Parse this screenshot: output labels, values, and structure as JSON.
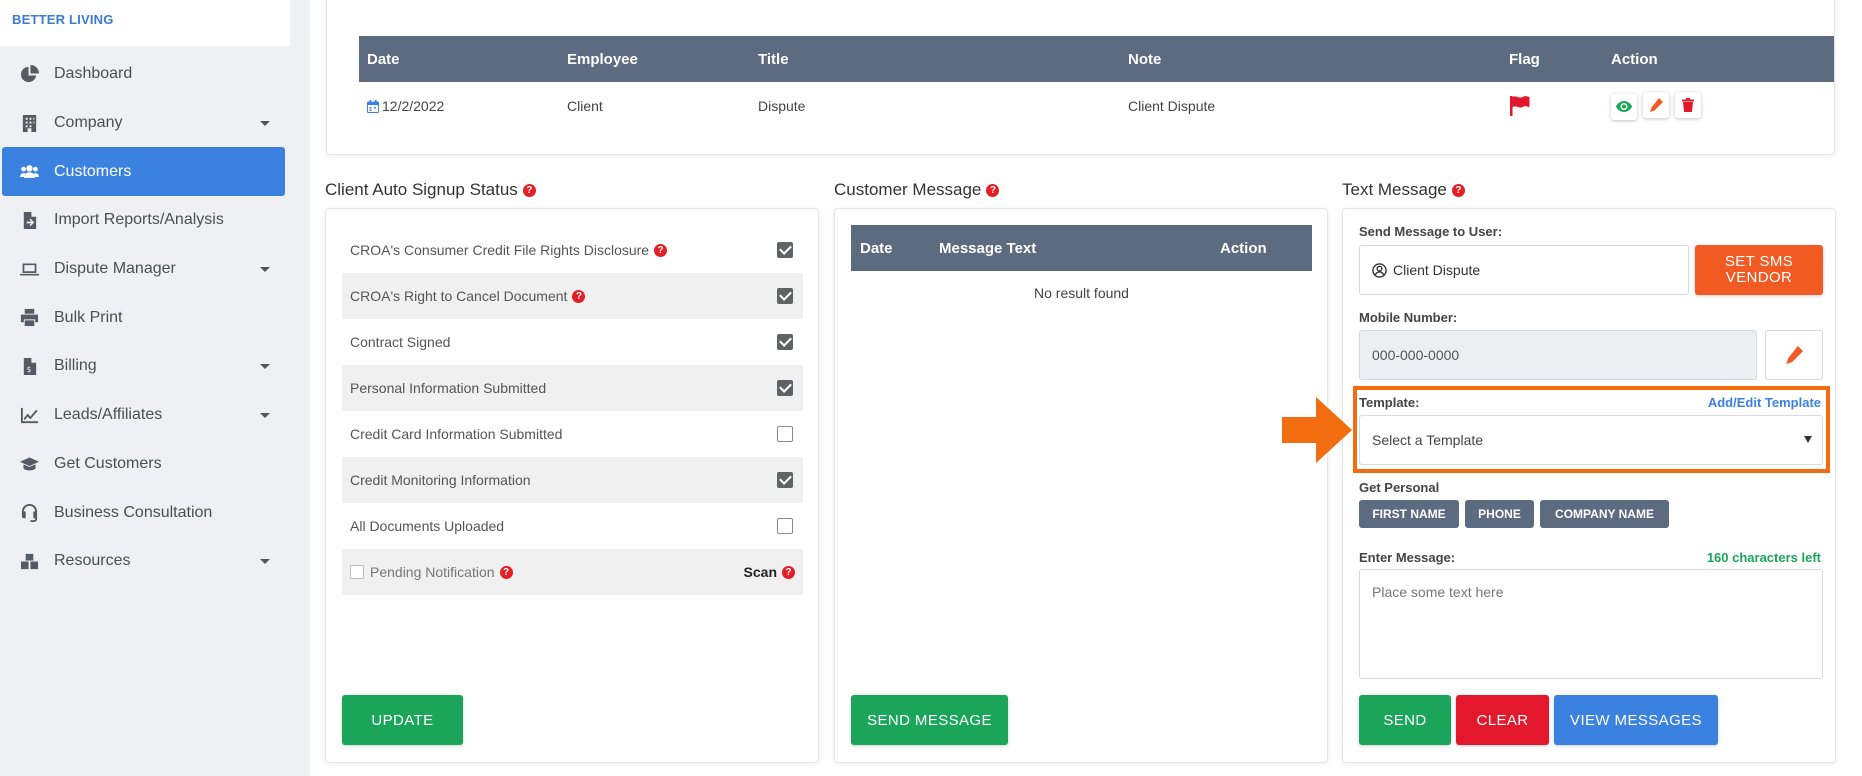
{
  "brand": "BETTER LIVING",
  "sidebar": {
    "items": [
      {
        "label": "Dashboard",
        "icon": "pie-chart-icon",
        "caret": false
      },
      {
        "label": "Company",
        "icon": "building-icon",
        "caret": true
      },
      {
        "label": "Customers",
        "icon": "users-icon",
        "caret": false,
        "active": true
      },
      {
        "label": "Import Reports/Analysis",
        "icon": "file-import-icon",
        "caret": false
      },
      {
        "label": "Dispute Manager",
        "icon": "laptop-icon",
        "caret": true
      },
      {
        "label": "Bulk Print",
        "icon": "printer-icon",
        "caret": false
      },
      {
        "label": "Billing",
        "icon": "invoice-icon",
        "caret": true
      },
      {
        "label": "Leads/Affiliates",
        "icon": "line-chart-icon",
        "caret": true
      },
      {
        "label": "Get Customers",
        "icon": "graduation-cap-icon",
        "caret": false
      },
      {
        "label": "Business Consultation",
        "icon": "headset-icon",
        "caret": false
      },
      {
        "label": "Resources",
        "icon": "boxes-icon",
        "caret": true
      }
    ]
  },
  "notes_table": {
    "headers": [
      "Date",
      "Employee",
      "Title",
      "Note",
      "Flag",
      "Action"
    ],
    "rows": [
      {
        "date": "12/2/2022",
        "employee": "Client",
        "title": "Dispute",
        "note": "Client Dispute"
      }
    ]
  },
  "signup": {
    "title": "Client Auto Signup Status",
    "items": [
      {
        "label": "CROA's Consumer Credit File Rights Disclosure",
        "help": true,
        "checked": true
      },
      {
        "label": "CROA's Right to Cancel Document",
        "help": true,
        "checked": true
      },
      {
        "label": "Contract Signed",
        "help": false,
        "checked": true
      },
      {
        "label": "Personal Information Submitted",
        "help": false,
        "checked": true
      },
      {
        "label": "Credit Card Information Submitted",
        "help": false,
        "checked": false
      },
      {
        "label": "Credit Monitoring Information",
        "help": false,
        "checked": true
      },
      {
        "label": "All Documents Uploaded",
        "help": false,
        "checked": false
      }
    ],
    "pending_label": "Pending Notification",
    "scan_label": "Scan",
    "update_button": "UPDATE"
  },
  "customer_message": {
    "title": "Customer Message",
    "headers": [
      "Date",
      "Message Text",
      "Action"
    ],
    "empty_text": "No result found",
    "send_button": "SEND MESSAGE"
  },
  "text_message": {
    "title": "Text Message",
    "send_to_label": "Send Message to User:",
    "user_value": "Client Dispute",
    "set_vendor_button": "SET SMS VENDOR",
    "mobile_label": "Mobile Number:",
    "mobile_placeholder": "000-000-0000",
    "template_label": "Template:",
    "add_edit_template_link": "Add/Edit Template",
    "template_select": "Select a Template",
    "get_personal_label": "Get Personal",
    "chips": [
      "FIRST NAME",
      "PHONE",
      "COMPANY NAME"
    ],
    "enter_message_label": "Enter Message:",
    "chars_left": "160 characters left",
    "message_placeholder": "Place some text here",
    "send_button": "SEND",
    "clear_button": "CLEAR",
    "view_messages_button": "VIEW MESSAGES"
  },
  "colors": {
    "primary_blue": "#3b82e0",
    "green": "#1ba55a",
    "red": "#e3182d",
    "orange": "#f15a22",
    "table_header": "#5c6b80"
  }
}
